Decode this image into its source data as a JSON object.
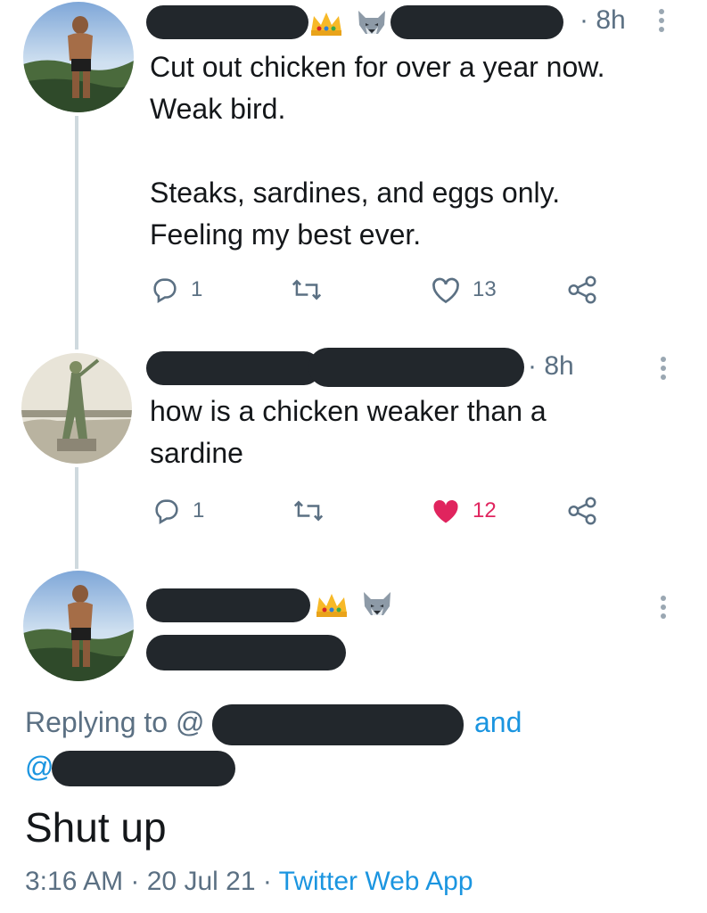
{
  "tweet1": {
    "time": "· 8h",
    "text": "Cut out chicken for over a year now.\nWeak bird.\n\nSteaks, sardines, and eggs only.\nFeeling my best ever.",
    "reply_count": "1",
    "like_count": "13",
    "badge_icons": [
      "crown-emoji",
      "wolf-emoji"
    ]
  },
  "tweet2": {
    "time": "· 8h",
    "text": "how is a chicken weaker than a\nsardine",
    "reply_count": "1",
    "like_count": "12",
    "liked": true
  },
  "tweet3": {
    "badge_icons": [
      "crown-emoji",
      "wolf-emoji"
    ],
    "replying_prefix": "Replying to @",
    "replying_and": "and",
    "replying_at": "@",
    "text": "Shut up",
    "time": "3:16 AM",
    "date": "20 Jul 21",
    "source": "Twitter Web App"
  },
  "colors": {
    "link": "#1b95e0",
    "like_active": "#e0245e",
    "muted": "#5b7083",
    "redaction": "#22272c"
  }
}
